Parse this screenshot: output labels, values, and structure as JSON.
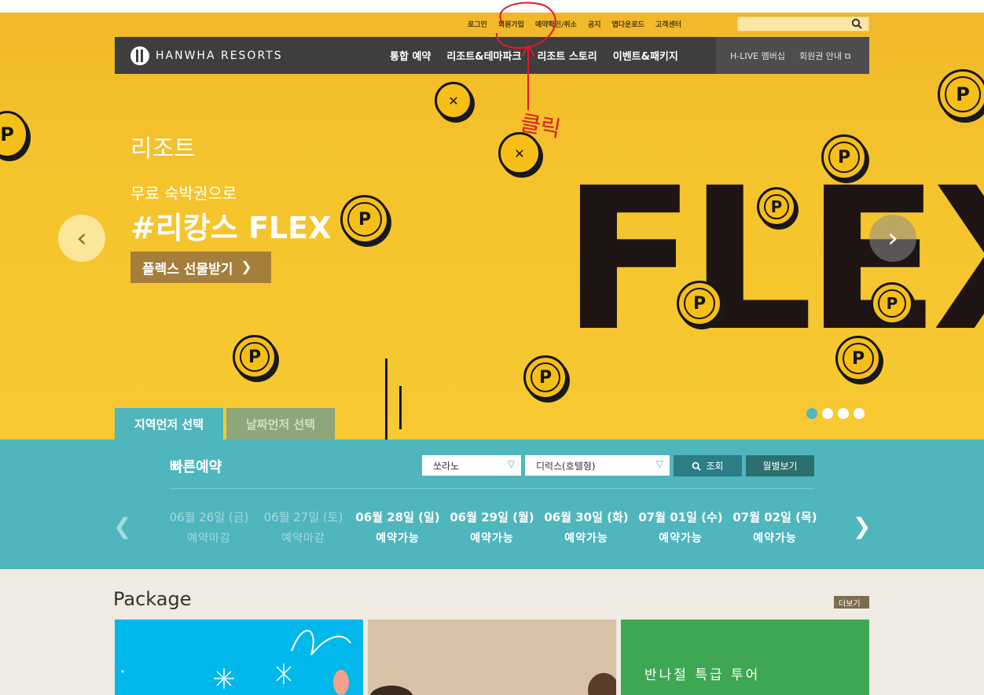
{
  "util_links": [
    "로그인",
    "회원가입",
    "예약확인/취소",
    "공지",
    "앱다운로드",
    "고객센터"
  ],
  "brand": "HANWHA RESORTS",
  "nav_menu": [
    "통합 예약",
    "리조트&테마파크",
    "리조트 스토리",
    "이벤트&패키지"
  ],
  "nav_right": [
    "H-LIVE 멤버십",
    "회원권 안내"
  ],
  "hero": {
    "category": "리조트",
    "subtitle": "무료 숙박권으로",
    "headline": "#리캉스 FLEX",
    "cta": "플렉스 선물받기",
    "art_text": "FLEX",
    "coin_letter": "P",
    "slides": 4,
    "active_slide": 1
  },
  "tabs": [
    "지역먼저 선택",
    "날짜먼저 선택"
  ],
  "booking": {
    "title": "빠른예약",
    "resort": "쏘라노",
    "room": "디럭스(호텔형)",
    "search_button": "조회",
    "monthly_button": "월별보기",
    "dates": [
      {
        "date": "06월 26일 (금)",
        "status": "예약마감",
        "available": false
      },
      {
        "date": "06월 27일 (토)",
        "status": "예약마감",
        "available": false
      },
      {
        "date": "06월 28일 (일)",
        "status": "예약가능",
        "available": true
      },
      {
        "date": "06월 29일 (월)",
        "status": "예약가능",
        "available": true
      },
      {
        "date": "06월 30일 (화)",
        "status": "예약가능",
        "available": true
      },
      {
        "date": "07월 01일 (수)",
        "status": "예약가능",
        "available": true
      },
      {
        "date": "07월 02일 (목)",
        "status": "예약가능",
        "available": true
      }
    ]
  },
  "package": {
    "title": "Package",
    "more": "더보기",
    "card3_text": "반나절 특급 투어"
  },
  "annotation": "클릭",
  "colors": {
    "teal": "#4fb6bd",
    "hero_yellow": "#f5c42c",
    "nav_dark": "#3e3e3f",
    "cta_brown": "#a47e3a"
  }
}
